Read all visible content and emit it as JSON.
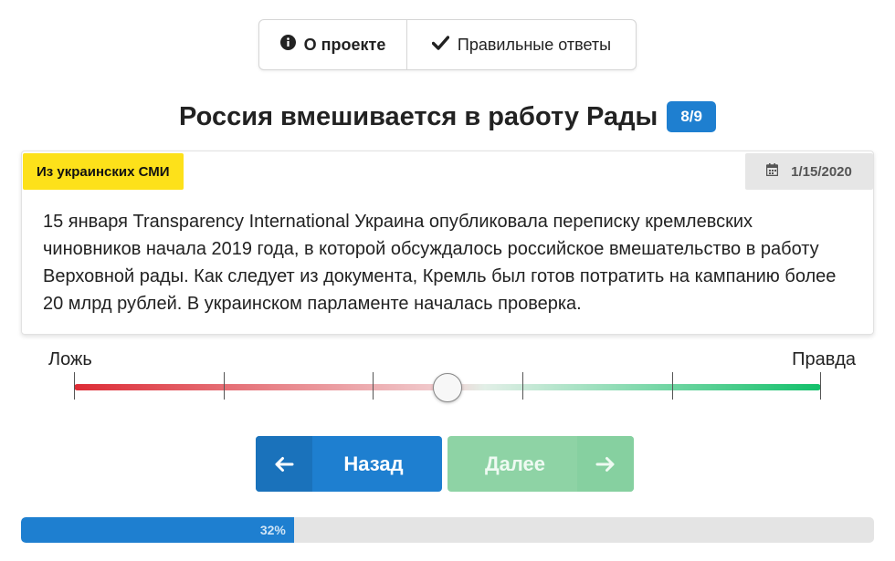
{
  "tabs": {
    "about": {
      "label": "О проекте",
      "icon": "info-circle-icon"
    },
    "answers": {
      "label": "Правильные ответы",
      "icon": "check-icon"
    }
  },
  "question": {
    "title": "Россия вмешивается в работу Рады",
    "counter": "8/9"
  },
  "card": {
    "source": "Из украинских СМИ",
    "date": "1/15/2020",
    "text": "15 января Transparency International Украина опубликовала переписку кремлевских чиновников начала 2019 года, в которой обсуждалось российское вмешательство в работу Верховной рады. Как следует из документа, Кремль был готов потратить на кампанию более 20 млрд рублей. В украинском парламенте началась проверка."
  },
  "scale": {
    "left_label": "Ложь",
    "right_label": "Правда",
    "value": 0.5,
    "steps": 5
  },
  "nav": {
    "back_label": "Назад",
    "next_label": "Далее"
  },
  "progress": {
    "label": "32%",
    "value": 0.32
  },
  "colors": {
    "accent": "#1e7fd0",
    "source_tag": "#fde11a",
    "false_color": "#dd2b35",
    "true_color": "#12c06a",
    "next_disabled": "#8ed3a5"
  }
}
